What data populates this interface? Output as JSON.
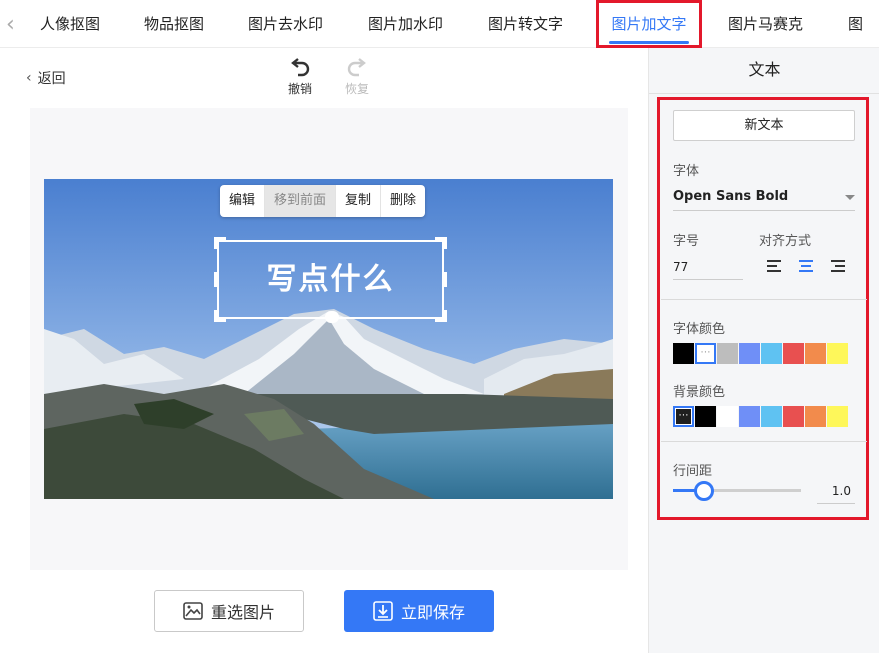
{
  "tabs": [
    {
      "label": "人像抠图"
    },
    {
      "label": "物品抠图"
    },
    {
      "label": "图片去水印"
    },
    {
      "label": "图片加水印"
    },
    {
      "label": "图片转文字"
    },
    {
      "label": "图片加文字",
      "active": true
    },
    {
      "label": "图片马赛克"
    },
    {
      "label": "图"
    }
  ],
  "toolbar": {
    "back_label": "返回",
    "undo_label": "撤销",
    "redo_label": "恢复"
  },
  "context_menu": {
    "edit": "编辑",
    "bring_front": "移到前面",
    "copy": "复制",
    "delete": "删除"
  },
  "canvas": {
    "text": "写点什么"
  },
  "actions": {
    "reselect_label": "重选图片",
    "save_label": "立即保存"
  },
  "panel": {
    "title": "文本",
    "new_text_label": "新文本",
    "font_label": "字体",
    "font_value": "Open Sans Bold",
    "size_label": "字号",
    "size_value": "77",
    "align_label": "对齐方式",
    "align_selected": "center",
    "font_color_label": "字体颜色",
    "font_colors": [
      "#000000",
      "#ffffff",
      "#bdbdbd",
      "#6f8ff7",
      "#5fc2f2",
      "#e85050",
      "#f28b4c",
      "#fef75a"
    ],
    "font_color_selected": 1,
    "bg_color_label": "背景颜色",
    "bg_colors": [
      "#1f1f1f",
      "#000000",
      "#ffffff",
      "#6f8ff7",
      "#5fc2f2",
      "#e85050",
      "#f28b4c",
      "#fef75a"
    ],
    "bg_color_selected": 0,
    "line_spacing_label": "行间距",
    "line_spacing_value": "1.0"
  },
  "colors": {
    "accent": "#3478f6",
    "highlight": "#e3182b"
  }
}
